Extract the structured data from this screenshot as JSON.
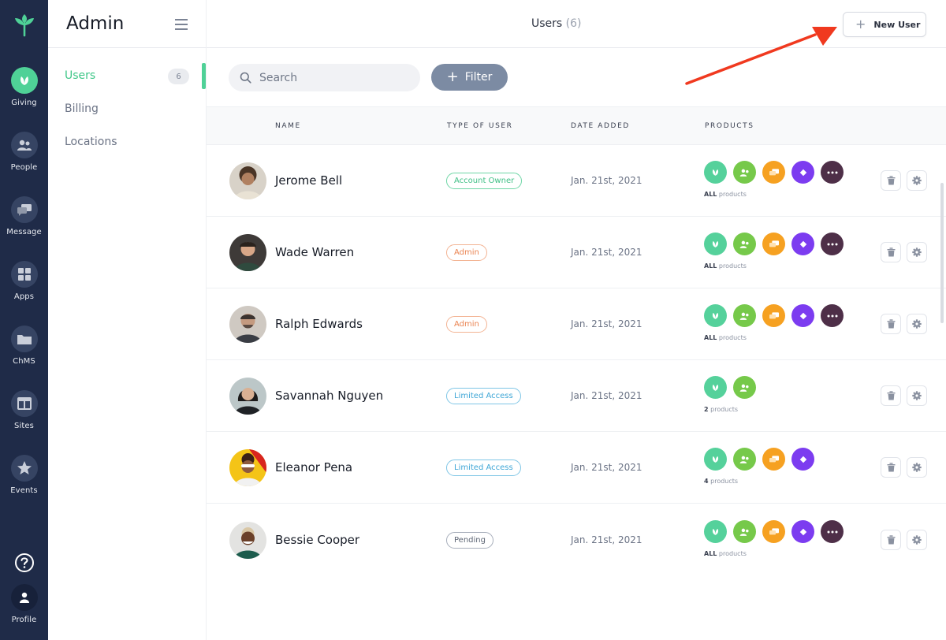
{
  "rail": {
    "items": [
      {
        "label": "Giving",
        "icon": "giving-icon"
      },
      {
        "label": "People",
        "icon": "people-icon"
      },
      {
        "label": "Message",
        "icon": "message-icon"
      },
      {
        "label": "Apps",
        "icon": "apps-icon"
      },
      {
        "label": "ChMS",
        "icon": "chms-icon"
      },
      {
        "label": "Sites",
        "icon": "sites-icon"
      },
      {
        "label": "Events",
        "icon": "events-icon"
      }
    ],
    "help_icon": "help-icon",
    "profile_label": "Profile"
  },
  "sidebar": {
    "title": "Admin",
    "items": [
      {
        "label": "Users",
        "count": "6"
      },
      {
        "label": "Billing"
      },
      {
        "label": "Locations"
      }
    ]
  },
  "header": {
    "title": "Users",
    "count": "(6)",
    "new_user_label": "New User"
  },
  "toolbar": {
    "search_placeholder": "Search",
    "filter_label": "Filter"
  },
  "table": {
    "columns": [
      "NAME",
      "TYPE OF USER",
      "DATE ADDED",
      "PRODUCTS"
    ],
    "rows": [
      {
        "name": "Jerome Bell",
        "type": "Account Owner",
        "date": "Jan. 21st, 2021",
        "products_count": "ALL",
        "products_suffix": " products"
      },
      {
        "name": "Wade Warren",
        "type": "Admin",
        "date": "Jan. 21st, 2021",
        "products_count": "ALL",
        "products_suffix": " products"
      },
      {
        "name": "Ralph Edwards",
        "type": "Admin",
        "date": "Jan. 21st, 2021",
        "products_count": "ALL",
        "products_suffix": " products"
      },
      {
        "name": "Savannah Nguyen",
        "type": "Limited Access",
        "date": "Jan. 21st, 2021",
        "products_count": "2",
        "products_suffix": " products"
      },
      {
        "name": "Eleanor Pena",
        "type": "Limited Access",
        "date": "Jan. 21st, 2021",
        "products_count": "4",
        "products_suffix": " products"
      },
      {
        "name": "Bessie Cooper",
        "type": "Pending",
        "date": "Jan. 21st, 2021",
        "products_count": "ALL",
        "products_suffix": " products"
      }
    ]
  },
  "colors": {
    "rail_bg": "#1f2b48",
    "accent": "#4fd197",
    "filter_bg": "#7c8ba3",
    "annotation_arrow": "#f0391f"
  }
}
